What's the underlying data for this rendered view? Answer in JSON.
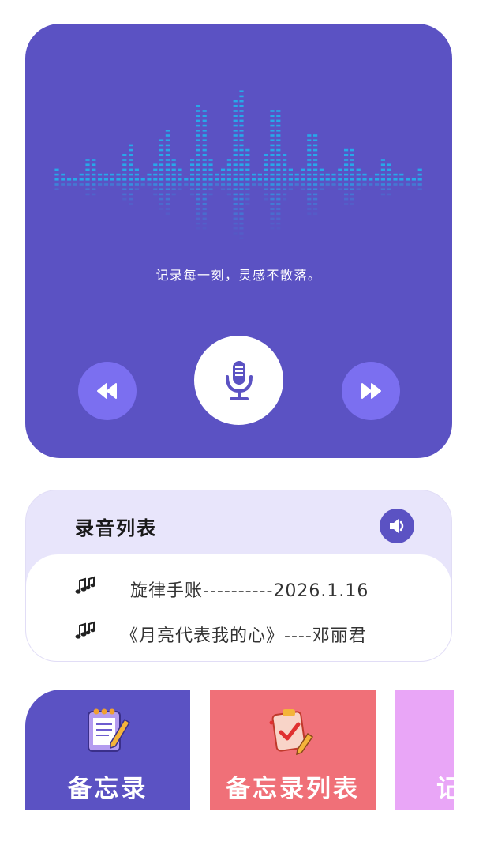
{
  "player": {
    "slogan": "记录每一刻，灵感不散落。",
    "rewind_icon": "rewind-icon",
    "mic_icon": "microphone-icon",
    "forward_icon": "fast-forward-icon",
    "colors": {
      "card": "#5b52c3",
      "wave": "#27a9ea",
      "button": "#7b6ff0"
    }
  },
  "recordings": {
    "title": "录音列表",
    "speaker_icon": "speaker-icon",
    "items": [
      {
        "icon": "music-note-icon",
        "text": "旋律手账----------2026.1.16"
      },
      {
        "icon": "music-note-icon",
        "text": "《月亮代表我的心》----邓丽君"
      }
    ]
  },
  "tiles": [
    {
      "label": "备忘录",
      "icon": "notepad-icon",
      "color": "#5b52c3"
    },
    {
      "label": "备忘录列表",
      "icon": "clipboard-checklist-icon",
      "color": "#f07078"
    },
    {
      "label": "记",
      "icon": "",
      "color": "#e9a6f7"
    }
  ]
}
